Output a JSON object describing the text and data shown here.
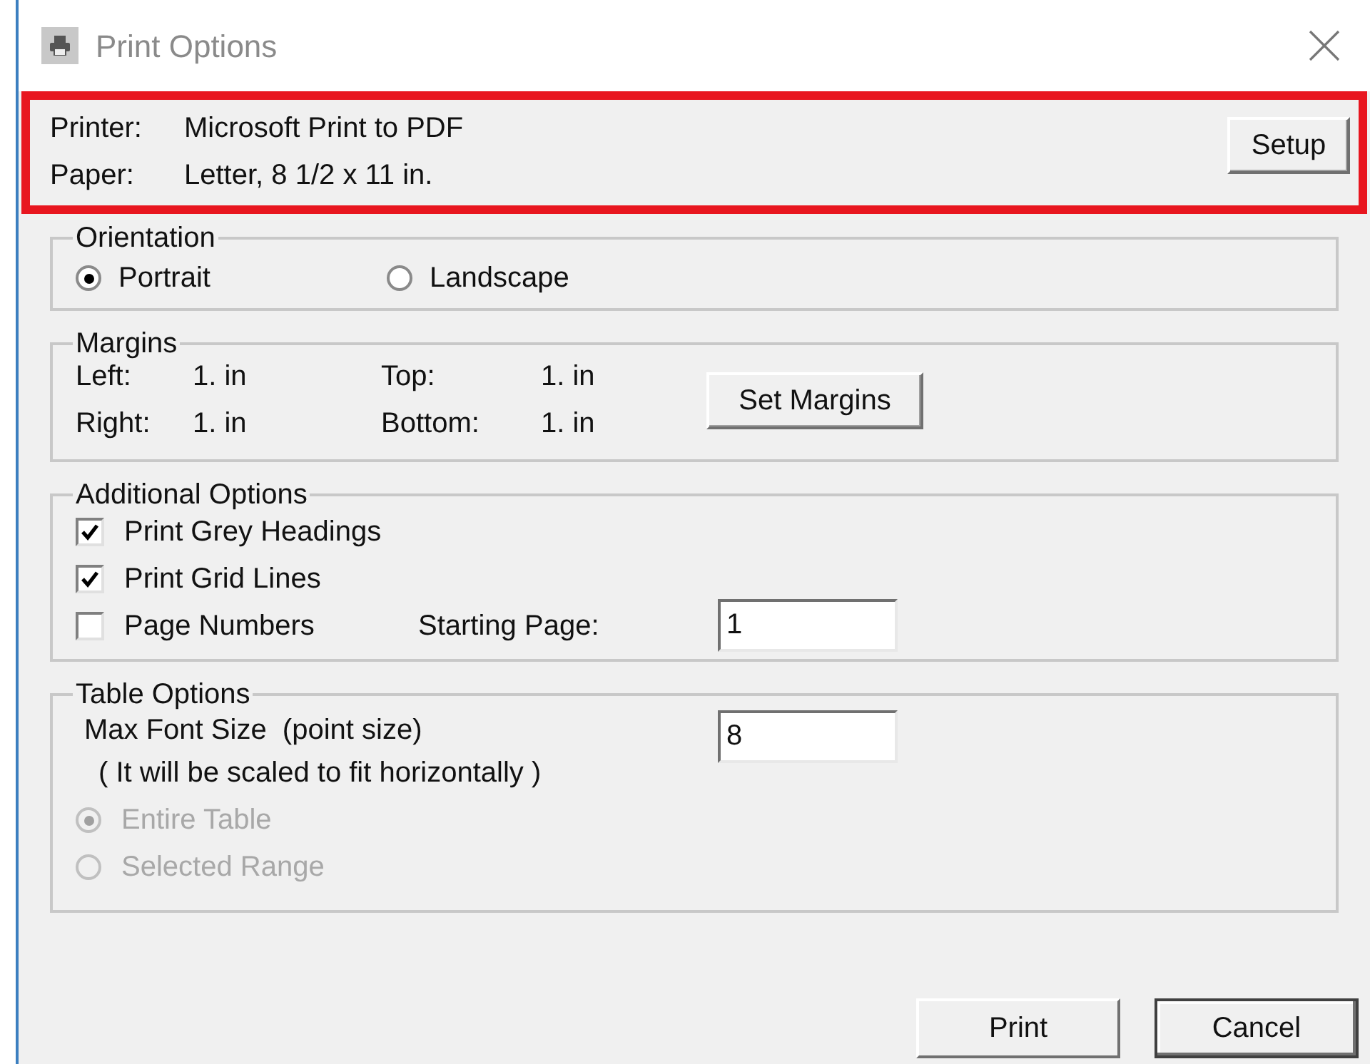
{
  "window": {
    "title": "Print Options"
  },
  "printer_info": {
    "highlighted": true,
    "printer_label": "Printer:",
    "printer": "Microsoft Print to PDF",
    "paper_label": "Paper:",
    "paper": "Letter, 8 1/2 x 11 in.",
    "setup_button": "Setup"
  },
  "orientation": {
    "legend": "Orientation",
    "options": [
      {
        "label": "Portrait",
        "selected": true
      },
      {
        "label": "Landscape",
        "selected": false
      }
    ]
  },
  "margins": {
    "legend": "Margins",
    "fields": [
      {
        "label": "Left:",
        "value": "1. in"
      },
      {
        "label": "Top:",
        "value": "1. in"
      },
      {
        "label": "Right:",
        "value": "1. in"
      },
      {
        "label": "Bottom:",
        "value": "1. in"
      }
    ],
    "button": "Set Margins"
  },
  "additional_options": {
    "legend": "Additional Options",
    "options": [
      {
        "label": "Print Grey Headings",
        "checked": true
      },
      {
        "label": "Print Grid Lines",
        "checked": true
      },
      {
        "label": "Page Numbers",
        "checked": false
      }
    ],
    "starting_page": {
      "label": "Starting Page:",
      "value": "1"
    }
  },
  "table_options": {
    "legend": "Table Options",
    "max_font_label": "Max Font Size  (point size)",
    "max_font_value": "8",
    "note": "( It will be scaled to fit horizontally )",
    "scope": [
      {
        "label": "Entire Table",
        "selected": true,
        "disabled": true
      },
      {
        "label": "Selected Range",
        "selected": false,
        "disabled": true
      }
    ]
  },
  "buttons": [
    {
      "label": "Print",
      "default": false
    },
    {
      "label": "Cancel",
      "default": true
    }
  ]
}
